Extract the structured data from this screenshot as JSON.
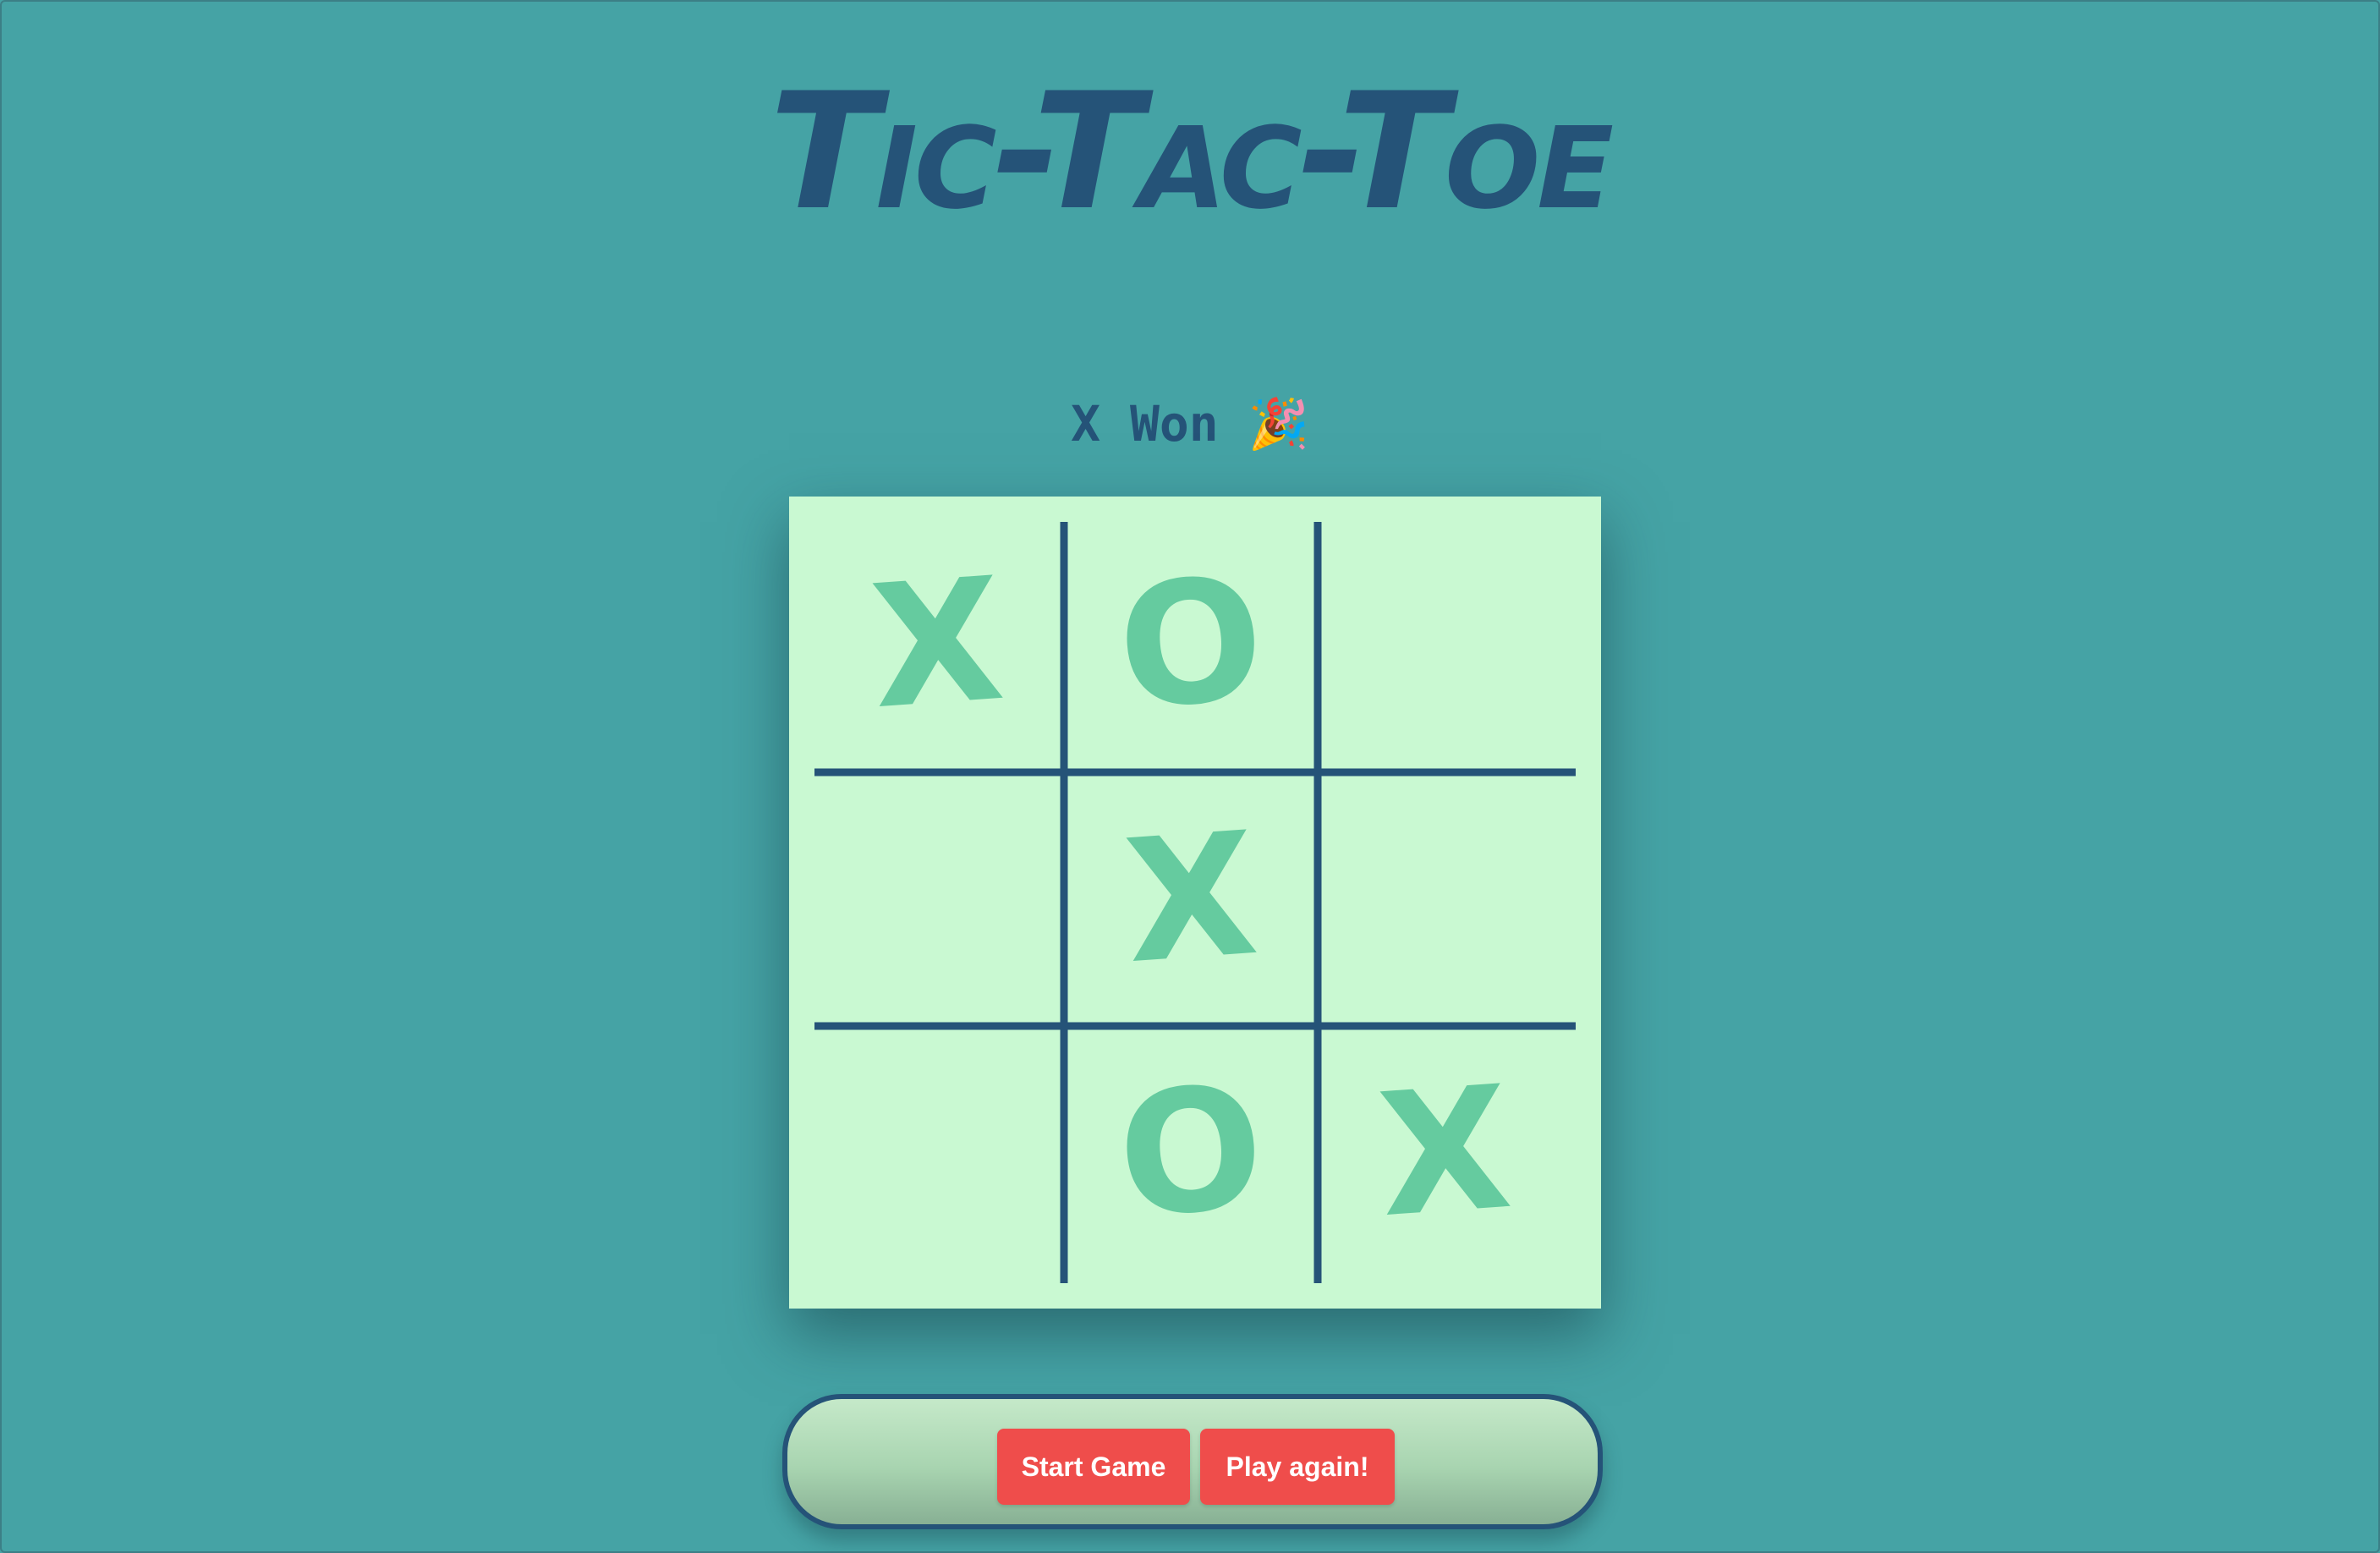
{
  "title": "Tic-Tac-Toe",
  "status": {
    "text": "X Won",
    "emoji": "🎉"
  },
  "board": {
    "cells": [
      "X",
      "O",
      "",
      "",
      "X",
      "",
      "",
      "O",
      "X"
    ]
  },
  "controls": {
    "start_label": "Start Game",
    "again_label": "Play again!"
  },
  "colors": {
    "background": "#45a3a5",
    "board": "#c9f9d2",
    "grid_lines": "#255378",
    "marks": "#65cb9f",
    "buttons": "#ef4d4b"
  }
}
